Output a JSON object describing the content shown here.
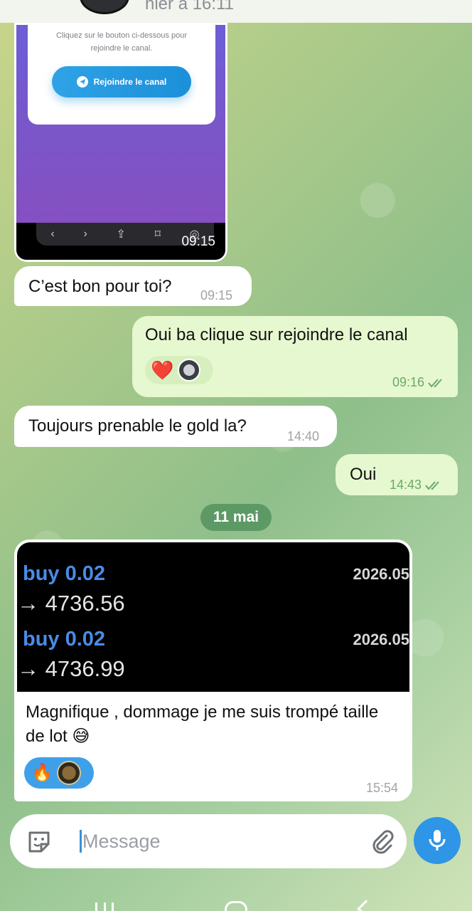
{
  "header": {
    "last_seen": "hier à 16:11"
  },
  "image_message": {
    "card_text": "Cliquez sur le bouton ci-dessous pour\nrejoindre le canal.",
    "button_label": "Rejoindre le canal",
    "time": "09:15"
  },
  "messages": [
    {
      "direction": "in",
      "text": "C’est bon pour toi?",
      "time": "09:15"
    },
    {
      "direction": "out",
      "text": "Oui ba clique sur rejoindre le canal",
      "time": "09:16",
      "reactions": [
        "❤️",
        "avatar"
      ]
    },
    {
      "direction": "in",
      "text": "Toujours prenable le gold la?",
      "time": "14:40"
    },
    {
      "direction": "out",
      "text": "Oui",
      "time": "14:43"
    }
  ],
  "date_separator": "11 mai",
  "trade_message": {
    "trades": [
      {
        "side": "buy 0.02",
        "date": "2026.05",
        "price": "→ 4736.56"
      },
      {
        "side": "buy 0.02",
        "date": "2026.05",
        "price": "→ 4736.99"
      }
    ],
    "text": "Magnifique , dommage je me suis trompé taille de lot 😅",
    "reactions": [
      "🔥",
      "avatar"
    ],
    "time": "15:54"
  },
  "composer": {
    "placeholder": "Message"
  },
  "colors": {
    "accent": "#2f95e6",
    "out_bubble": "#e6f8cf",
    "date_chip": "#4c8c58"
  },
  "icons": [
    "sticker-icon",
    "attach-icon",
    "mic-icon",
    "telegram-icon",
    "double-check-icon"
  ]
}
